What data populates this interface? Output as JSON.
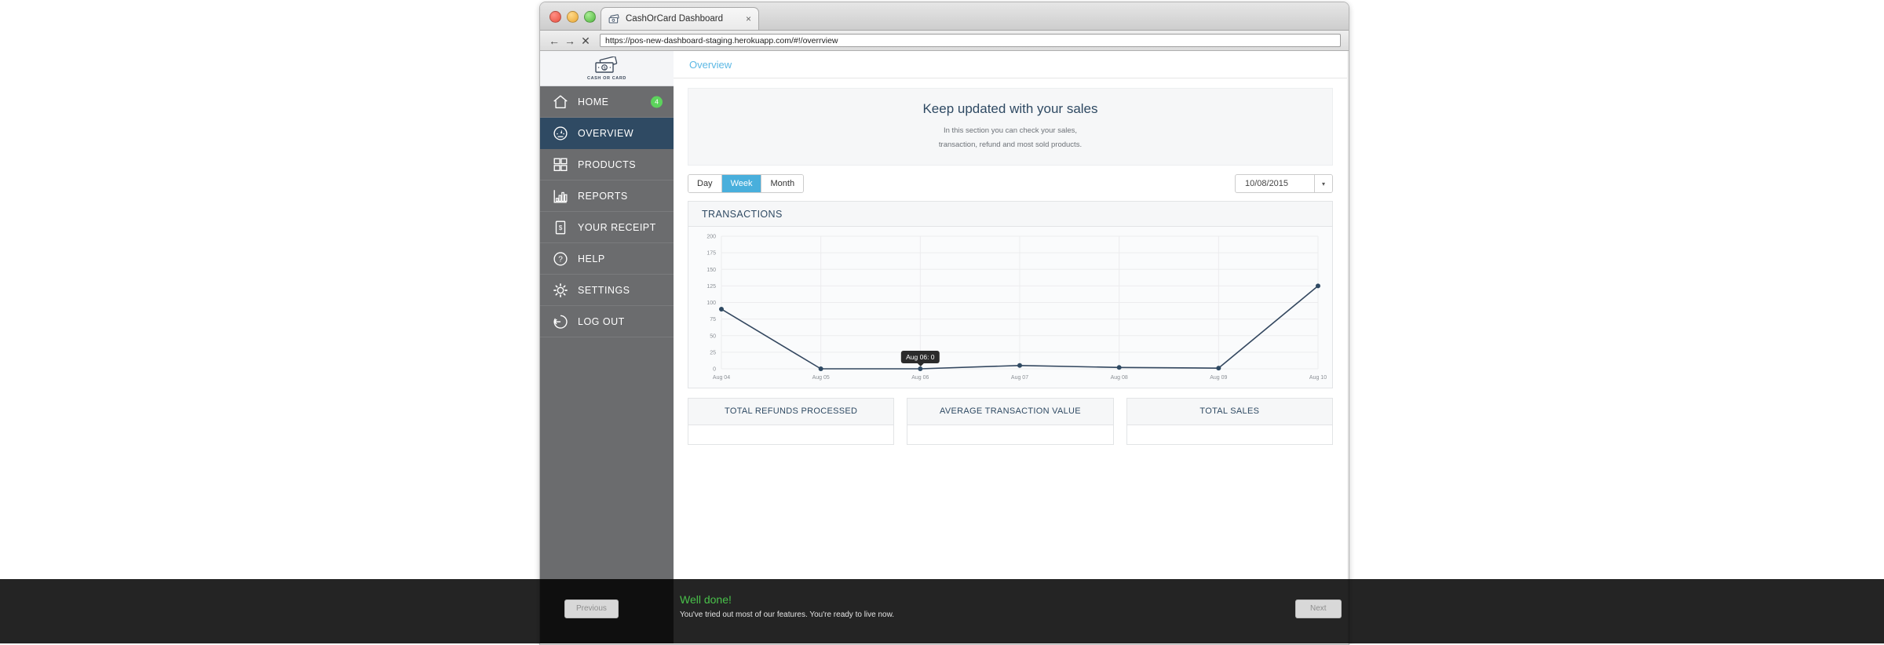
{
  "browser": {
    "tab_title": "CashOrCard Dashboard",
    "tab_close": "×",
    "favicon_name": "cash-card-favicon",
    "back_glyph": "←",
    "forward_glyph": "→",
    "stop_glyph": "✕",
    "url": "https://pos-new-dashboard-staging.herokuapp.com/#!/overrview"
  },
  "sidebar": {
    "logo_text": "CASH OR CARD",
    "items": [
      {
        "label": "HOME",
        "icon": "home-icon",
        "active": false,
        "badge": "4"
      },
      {
        "label": "OVERVIEW",
        "icon": "gauge-icon",
        "active": true,
        "badge": ""
      },
      {
        "label": "PRODUCTS",
        "icon": "grid-icon",
        "active": false,
        "badge": ""
      },
      {
        "label": "REPORTS",
        "icon": "bar-chart-icon",
        "active": false,
        "badge": ""
      },
      {
        "label": "YOUR RECEIPT",
        "icon": "receipt-icon",
        "active": false,
        "badge": ""
      },
      {
        "label": "HELP",
        "icon": "question-icon",
        "active": false,
        "badge": ""
      },
      {
        "label": "SETTINGS",
        "icon": "gear-icon",
        "active": false,
        "badge": ""
      },
      {
        "label": "LOG OUT",
        "icon": "logout-icon",
        "active": false,
        "badge": ""
      }
    ]
  },
  "main": {
    "breadcrumb": "Overview",
    "hero_title": "Keep updated with your sales",
    "hero_line1": "In this section you can check your sales,",
    "hero_line2": "transaction, refund and most sold products.",
    "range_tabs": [
      {
        "label": "Day",
        "active": false
      },
      {
        "label": "Week",
        "active": true
      },
      {
        "label": "Month",
        "active": false
      }
    ],
    "date_value": "10/08/2015",
    "date_caret": "▾",
    "chart_card_title": "TRANSACTIONS",
    "stats": [
      {
        "title": "TOTAL REFUNDS PROCESSED"
      },
      {
        "title": "AVERAGE TRANSACTION VALUE"
      },
      {
        "title": "TOTAL SALES"
      }
    ]
  },
  "chart_data": {
    "type": "line",
    "title": "TRANSACTIONS",
    "xlabel": "",
    "ylabel": "",
    "categories": [
      "Aug 04",
      "Aug 05",
      "Aug 06",
      "Aug 07",
      "Aug 08",
      "Aug 09",
      "Aug 10"
    ],
    "values": [
      90,
      0,
      0,
      5,
      2,
      1,
      125
    ],
    "ylim": [
      0,
      200
    ],
    "yticks": [
      0,
      25,
      50,
      75,
      100,
      125,
      150,
      175,
      200
    ],
    "grid": true,
    "legend": "none",
    "line_color": "#33475f",
    "point_color": "#2f4a63",
    "tooltip": {
      "text": "Aug 06: 0",
      "category": "Aug 06",
      "value": 0
    }
  },
  "tour": {
    "previous_label": "Previous",
    "headline": "Well done!",
    "body": "You've tried out most of our features. You're ready to live now.",
    "next_label": "Next"
  },
  "colors": {
    "sidebar_bg": "#6b6c6e",
    "sidebar_active": "#2f4a63",
    "accent_blue": "#49afdc",
    "link_blue": "#5cb8e4",
    "badge_green": "#5cd35c",
    "tour_green": "#49c14a",
    "navy": "#2f4a63"
  }
}
